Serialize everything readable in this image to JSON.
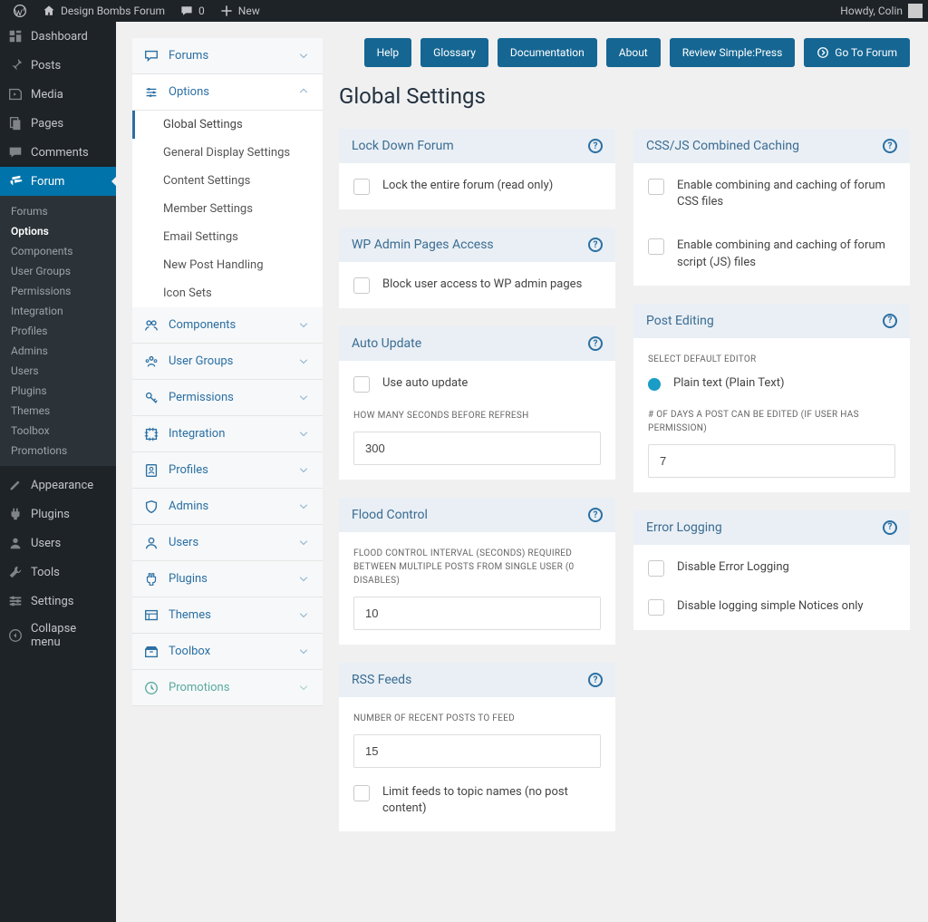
{
  "adminbar": {
    "site": "Design Bombs Forum",
    "comments": "0",
    "new": "New",
    "howdy": "Howdy, Colin"
  },
  "wpmenu": [
    {
      "label": "Dashboard",
      "icon": "dash"
    },
    {
      "label": "Posts",
      "icon": "pin"
    },
    {
      "label": "Media",
      "icon": "media"
    },
    {
      "label": "Pages",
      "icon": "pages"
    },
    {
      "label": "Comments",
      "icon": "comment"
    },
    {
      "label": "Forum",
      "icon": "forum",
      "current": true
    },
    {
      "label": "Appearance",
      "icon": "appearance"
    },
    {
      "label": "Plugins",
      "icon": "plugin"
    },
    {
      "label": "Users",
      "icon": "user"
    },
    {
      "label": "Tools",
      "icon": "tool"
    },
    {
      "label": "Settings",
      "icon": "settings"
    },
    {
      "label": "Collapse menu",
      "icon": "collapse"
    }
  ],
  "forum_submenu": [
    "Forums",
    "Options",
    "Components",
    "User Groups",
    "Permissions",
    "Integration",
    "Profiles",
    "Admins",
    "Users",
    "Plugins",
    "Themes",
    "Toolbox",
    "Promotions"
  ],
  "sp_panel": {
    "sections": [
      {
        "label": "Forums",
        "icon": "chat"
      },
      {
        "label": "Options",
        "icon": "sliders",
        "open": true,
        "items": [
          "Global Settings",
          "General Display Settings",
          "Content Settings",
          "Member Settings",
          "Email Settings",
          "New Post Handling",
          "Icon Sets"
        ]
      },
      {
        "label": "Components",
        "icon": "users"
      },
      {
        "label": "User Groups",
        "icon": "group"
      },
      {
        "label": "Permissions",
        "icon": "key"
      },
      {
        "label": "Integration",
        "icon": "int"
      },
      {
        "label": "Profiles",
        "icon": "profile"
      },
      {
        "label": "Admins",
        "icon": "shield"
      },
      {
        "label": "Users",
        "icon": "person"
      },
      {
        "label": "Plugins",
        "icon": "pluginb"
      },
      {
        "label": "Themes",
        "icon": "theme"
      },
      {
        "label": "Toolbox",
        "icon": "box"
      },
      {
        "label": "Promotions",
        "icon": "promo"
      }
    ]
  },
  "topbtns": [
    "Help",
    "Glossary",
    "Documentation",
    "About",
    "Review Simple:Press",
    "Go To Forum"
  ],
  "page_title": "Global Settings",
  "cards": {
    "lockdown": {
      "title": "Lock Down Forum",
      "opt1": "Lock the entire forum (read only)"
    },
    "wpadmin": {
      "title": "WP Admin Pages Access",
      "opt1": "Block user access to WP admin pages"
    },
    "auto": {
      "title": "Auto Update",
      "opt1": "Use auto update",
      "label1": "HOW MANY SECONDS BEFORE REFRESH",
      "val1": "300"
    },
    "flood": {
      "title": "Flood Control",
      "label1": "FLOOD CONTROL INTERVAL (SECONDS) REQUIRED BETWEEN MULTIPLE POSTS FROM SINGLE USER (0 DISABLES)",
      "val1": "10"
    },
    "rss": {
      "title": "RSS Feeds",
      "label1": "NUMBER OF RECENT POSTS TO FEED",
      "val1": "15",
      "opt1": "Limit feeds to topic names (no post content)"
    },
    "cache": {
      "title": "CSS/JS Combined Caching",
      "opt1": "Enable combining and caching of forum CSS files",
      "opt2": "Enable combining and caching of forum script (JS) files"
    },
    "editing": {
      "title": "Post Editing",
      "label1": "SELECT DEFAULT EDITOR",
      "opt1": "Plain text (Plain Text)",
      "label2": "# OF DAYS A POST CAN BE EDITED (IF USER HAS PERMISSION)",
      "val1": "7"
    },
    "error": {
      "title": "Error Logging",
      "opt1": "Disable Error Logging",
      "opt2": "Disable logging simple Notices only"
    }
  }
}
